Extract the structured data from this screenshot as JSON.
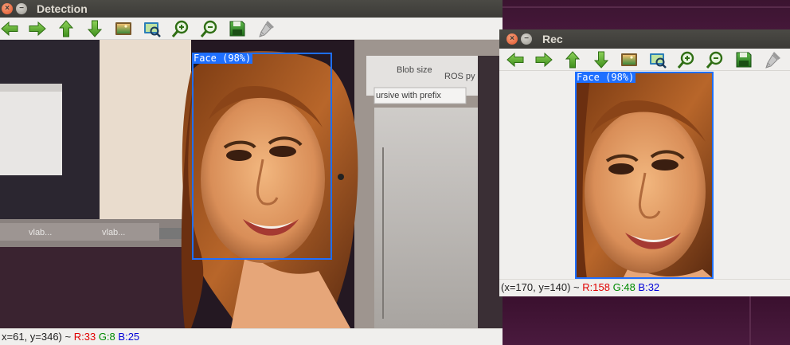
{
  "colors": {
    "box": "#1e6fff",
    "status_r": "#e00000",
    "status_g": "#008a00",
    "status_b": "#0000d8"
  },
  "detection_window": {
    "title": "Detection",
    "toolbar": [
      {
        "name": "pan-left-button",
        "icon": "arrow-left-icon"
      },
      {
        "name": "pan-right-button",
        "icon": "arrow-right-icon"
      },
      {
        "name": "pan-up-button",
        "icon": "arrow-up-icon"
      },
      {
        "name": "pan-down-button",
        "icon": "arrow-down-icon"
      },
      {
        "name": "zoom-fit-button",
        "icon": "image-fit-icon"
      },
      {
        "name": "zoom-original-button",
        "icon": "image-zoom-icon"
      },
      {
        "name": "zoom-in-button",
        "icon": "zoom-in-icon"
      },
      {
        "name": "zoom-out-button",
        "icon": "zoom-out-icon"
      },
      {
        "name": "save-button",
        "icon": "save-icon"
      },
      {
        "name": "properties-button",
        "icon": "brush-icon"
      }
    ],
    "label": "Face (98%)",
    "screen_texts": {
      "tab1": "vlab...",
      "tab2": "vlab...",
      "blob": "Blob size",
      "ros": "ROS py",
      "recursive": "ursive with prefix"
    },
    "status": {
      "coords": "x=61, y=346) ~",
      "r": "R:33",
      "g": "G:8",
      "b": "B:25"
    }
  },
  "rec_window": {
    "title": "Rec",
    "toolbar": [
      {
        "name": "pan-left-button",
        "icon": "arrow-left-icon"
      },
      {
        "name": "pan-right-button",
        "icon": "arrow-right-icon"
      },
      {
        "name": "pan-up-button",
        "icon": "arrow-up-icon"
      },
      {
        "name": "pan-down-button",
        "icon": "arrow-down-icon"
      },
      {
        "name": "zoom-fit-button",
        "icon": "image-fit-icon"
      },
      {
        "name": "zoom-original-button",
        "icon": "image-zoom-icon"
      },
      {
        "name": "zoom-in-button",
        "icon": "zoom-in-icon"
      },
      {
        "name": "zoom-out-button",
        "icon": "zoom-out-icon"
      },
      {
        "name": "save-button",
        "icon": "save-icon"
      },
      {
        "name": "properties-button",
        "icon": "brush-icon"
      }
    ],
    "label": "Face (98%)",
    "status": {
      "coords": "(x=170, y=140) ~",
      "r": "R:158",
      "g": "G:48",
      "b": "B:32"
    }
  }
}
